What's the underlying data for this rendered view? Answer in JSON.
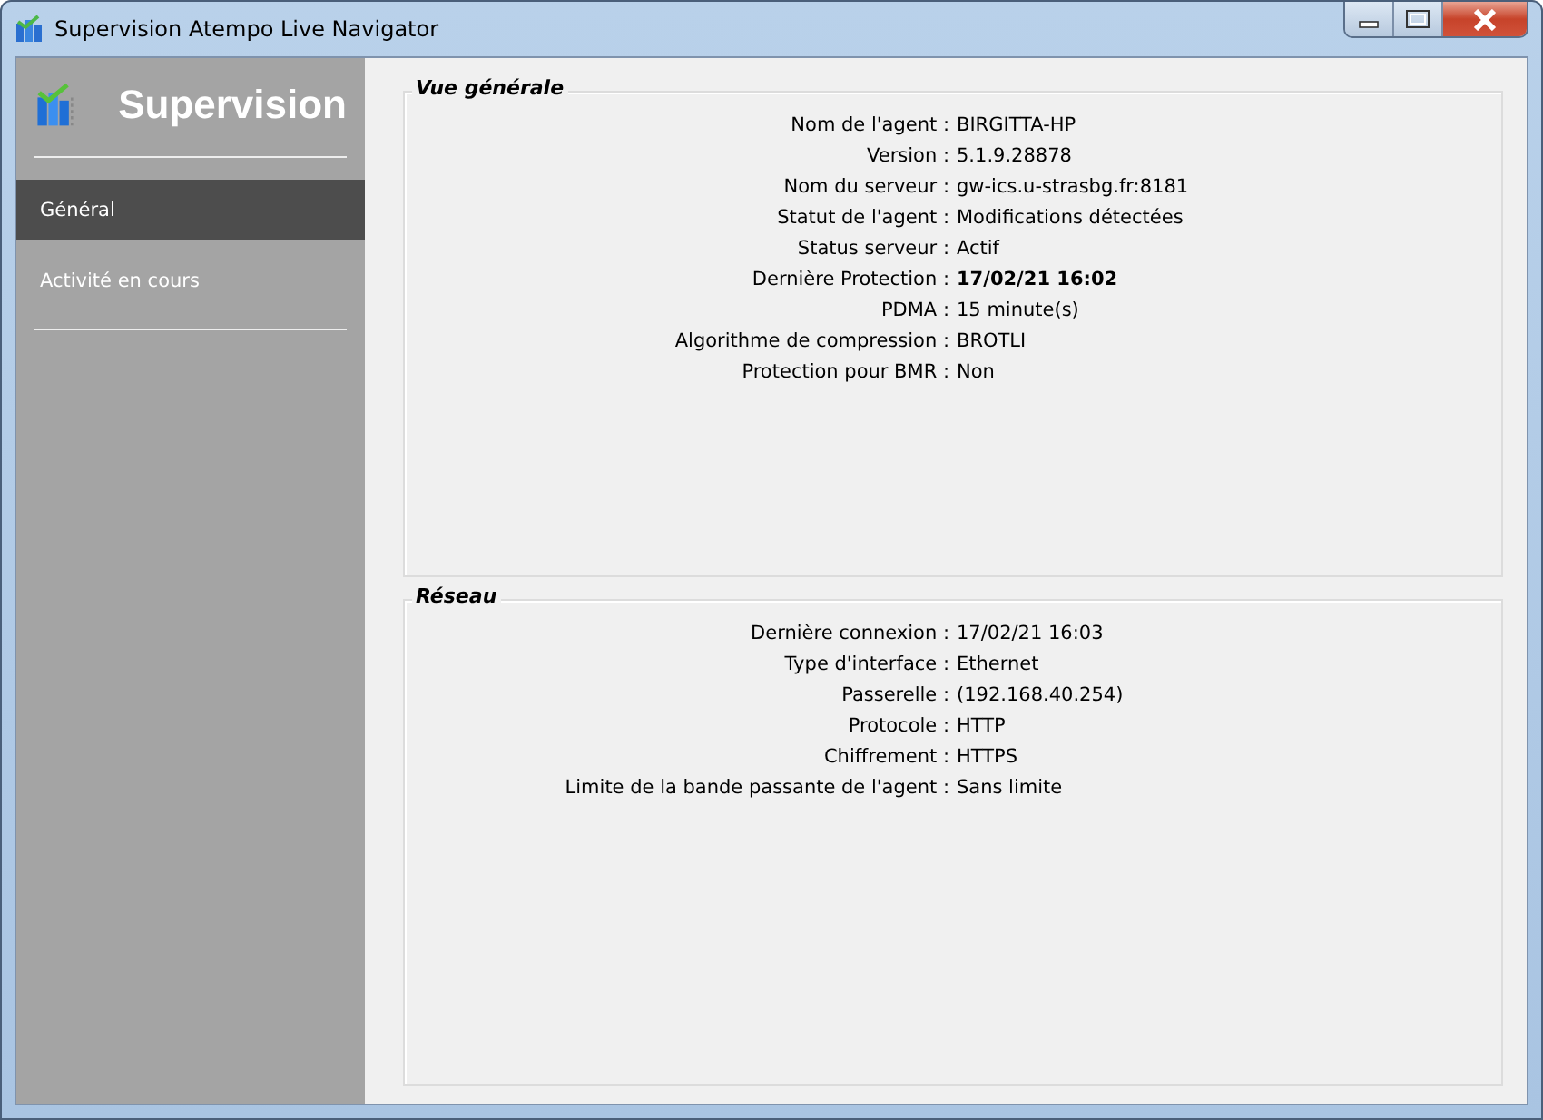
{
  "window": {
    "title": "Supervision Atempo Live Navigator"
  },
  "sidebar": {
    "title": "Supervision",
    "items": [
      {
        "label": "Général",
        "selected": true
      },
      {
        "label": "Activité en cours",
        "selected": false
      }
    ]
  },
  "sections": [
    {
      "title": "Vue générale",
      "rows": [
        {
          "label": "Nom de l'agent :",
          "value": "BIRGITTA-HP",
          "bold": false
        },
        {
          "label": "Version :",
          "value": "5.1.9.28878",
          "bold": false
        },
        {
          "label": "Nom du serveur :",
          "value": "gw-ics.u-strasbg.fr:8181",
          "bold": false
        },
        {
          "label": "Statut de l'agent :",
          "value": "Modifications détectées",
          "bold": false
        },
        {
          "label": "Status serveur :",
          "value": "Actif",
          "bold": false
        },
        {
          "label": "Dernière Protection :",
          "value": "17/02/21 16:02",
          "bold": true
        },
        {
          "label": "PDMA :",
          "value": "15 minute(s)",
          "bold": false
        },
        {
          "label": "Algorithme de compression :",
          "value": "BROTLI",
          "bold": false
        },
        {
          "label": "Protection pour BMR :",
          "value": "Non",
          "bold": false
        }
      ]
    },
    {
      "title": "Réseau",
      "rows": [
        {
          "label": "Dernière connexion :",
          "value": "17/02/21 16:03",
          "bold": false
        },
        {
          "label": "Type d'interface :",
          "value": "Ethernet",
          "bold": false
        },
        {
          "label": "Passerelle :",
          "value": "(192.168.40.254)",
          "bold": false
        },
        {
          "label": "Protocole :",
          "value": "HTTP",
          "bold": false
        },
        {
          "label": "Chiffrement :",
          "value": "HTTPS",
          "bold": false
        },
        {
          "label": "Limite de la bande passante de l'agent :",
          "value": "Sans limite",
          "bold": false
        }
      ]
    }
  ]
}
